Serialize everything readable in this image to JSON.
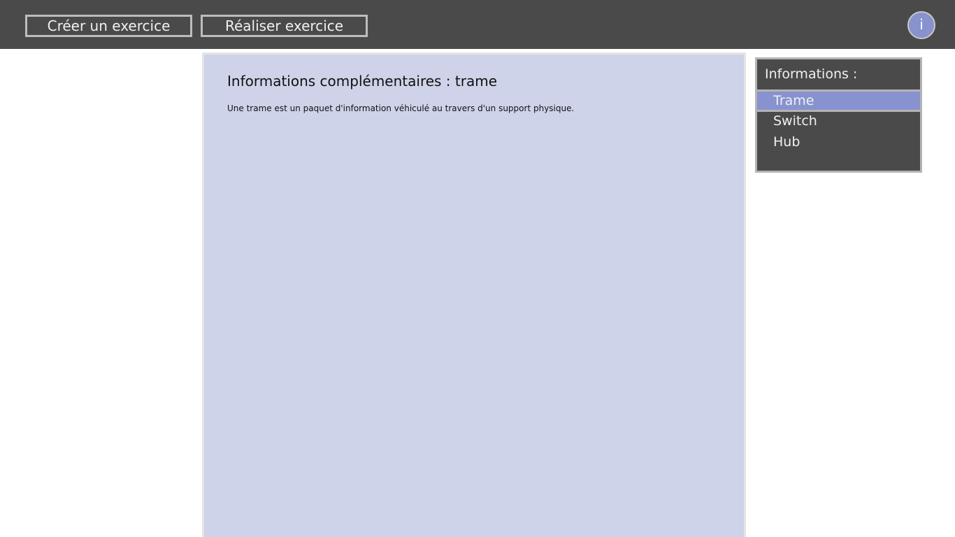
{
  "toolbar": {
    "create_exercise_label": "Créer un exercice",
    "do_exercise_label": "Réaliser exercice",
    "info_button_label": "i"
  },
  "content": {
    "title": "Informations complémentaires : trame",
    "text": "Une trame est un paquet d'information véhiculé au travers d'un support physique."
  },
  "info_panel": {
    "title": "Informations :",
    "items": [
      {
        "label": "Trame",
        "selected": true
      },
      {
        "label": "Switch",
        "selected": false
      },
      {
        "label": "Hub",
        "selected": false
      }
    ]
  },
  "colors": {
    "topbar": "#4a4a4a",
    "content_background": "#ced3e9",
    "accent": "#8792cf",
    "panel_background": "#4a4a4a"
  }
}
